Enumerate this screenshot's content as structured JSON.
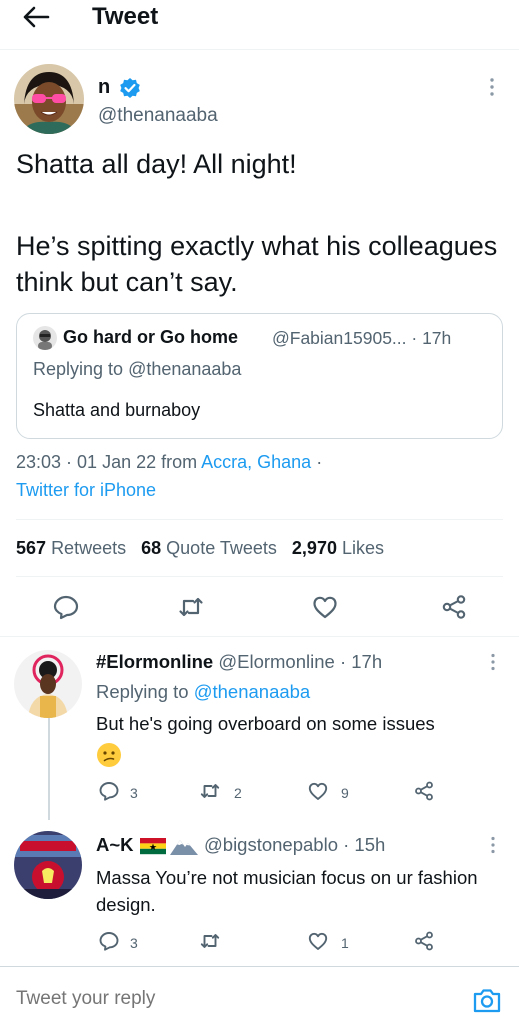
{
  "header": {
    "title": "Tweet",
    "back_icon": "arrow-left-icon"
  },
  "main_tweet": {
    "name": "n",
    "handle": "@thenanaaba",
    "text_line_1": "Shatta all day! All night!",
    "text_line_2": "He’s spitting exactly what his colleagues think but can’t say.",
    "quoted": {
      "name": "Go hard or Go home",
      "handle_time": "@Fabian15905... · 17h",
      "replying_prefix": "Replying to ",
      "replying_to": "@thenanaaba",
      "text": "Shatta and burnaboy"
    },
    "time": "23:03 · 01 Jan 22 from ",
    "location": "Accra, Ghana",
    "dot": " ·",
    "source": "Twitter for iPhone",
    "stats": {
      "retweets": "567",
      "retweets_label": "Retweets",
      "quotes": "68",
      "quotes_label": "Quote Tweets",
      "likes": "2,970",
      "likes_label": "Likes"
    }
  },
  "replies": [
    {
      "name": "#Elormonline",
      "handle_time": "@Elormonline · 17h",
      "replying_prefix": "Replying to ",
      "replying_to": "@thenanaaba",
      "text": "But he's going overboard on some issues",
      "emoji": "confused-face",
      "reply_count": "3",
      "retweet_count": "2",
      "like_count": "9"
    },
    {
      "name": "A~K",
      "handle_time": "@bigstonepablo · 15h",
      "text": "Massa You’re not musician focus on ur fashion design.",
      "reply_count": "3",
      "like_count": "1"
    }
  ],
  "compose": {
    "placeholder": "Tweet your reply",
    "icon": "camera-icon"
  },
  "colors": {
    "accent": "#1d9bf0",
    "text": "#0f1419",
    "muted": "#536471",
    "divider": "#eff3f4"
  }
}
